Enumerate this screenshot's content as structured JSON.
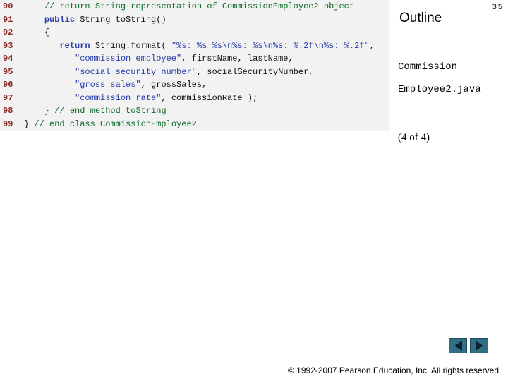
{
  "slide": {
    "title": "Outline",
    "page_number": "35",
    "filename_line1": "Commission",
    "filename_line2": "Employee2.java",
    "part_label": "(4 of 4)",
    "footer": "© 1992-2007 Pearson Education, Inc.  All rights reserved."
  },
  "code": {
    "lines": [
      {
        "num": "90",
        "tokens": [
          {
            "t": "    ",
            "c": "txt"
          },
          {
            "t": "// return String representation of CommissionEmployee2 object",
            "c": "cmt"
          }
        ]
      },
      {
        "num": "91",
        "tokens": [
          {
            "t": "    ",
            "c": "txt"
          },
          {
            "t": "public",
            "c": "kw"
          },
          {
            "t": " String toString()",
            "c": "txt"
          }
        ]
      },
      {
        "num": "92",
        "tokens": [
          {
            "t": "    {",
            "c": "txt"
          }
        ]
      },
      {
        "num": "93",
        "tokens": [
          {
            "t": "       ",
            "c": "txt"
          },
          {
            "t": "return",
            "c": "kw"
          },
          {
            "t": " String.format( ",
            "c": "txt"
          },
          {
            "t": "\"%s: %s %s\\n%s: %s\\n%s: %.2f\\n%s: %.2f\"",
            "c": "str"
          },
          {
            "t": ",",
            "c": "txt"
          }
        ]
      },
      {
        "num": "94",
        "tokens": [
          {
            "t": "          ",
            "c": "txt"
          },
          {
            "t": "\"commission employee\"",
            "c": "str"
          },
          {
            "t": ", firstName, lastName,",
            "c": "txt"
          }
        ]
      },
      {
        "num": "95",
        "tokens": [
          {
            "t": "          ",
            "c": "txt"
          },
          {
            "t": "\"social security number\"",
            "c": "str"
          },
          {
            "t": ", socialSecurityNumber,",
            "c": "txt"
          }
        ]
      },
      {
        "num": "96",
        "tokens": [
          {
            "t": "          ",
            "c": "txt"
          },
          {
            "t": "\"gross sales\"",
            "c": "str"
          },
          {
            "t": ", grossSales,",
            "c": "txt"
          }
        ]
      },
      {
        "num": "97",
        "tokens": [
          {
            "t": "          ",
            "c": "txt"
          },
          {
            "t": "\"commission rate\"",
            "c": "str"
          },
          {
            "t": ", commissionRate );",
            "c": "txt"
          }
        ]
      },
      {
        "num": "98",
        "tokens": [
          {
            "t": "    } ",
            "c": "txt"
          },
          {
            "t": "// end method toString",
            "c": "cmt"
          }
        ]
      },
      {
        "num": "99",
        "tokens": [
          {
            "t": "} ",
            "c": "txt"
          },
          {
            "t": "// end class CommissionEmployee2",
            "c": "cmt"
          }
        ]
      }
    ]
  },
  "nav": {
    "prev_icon": "arrow-left-icon",
    "next_icon": "arrow-right-icon",
    "button_color": "#2f6e84"
  }
}
